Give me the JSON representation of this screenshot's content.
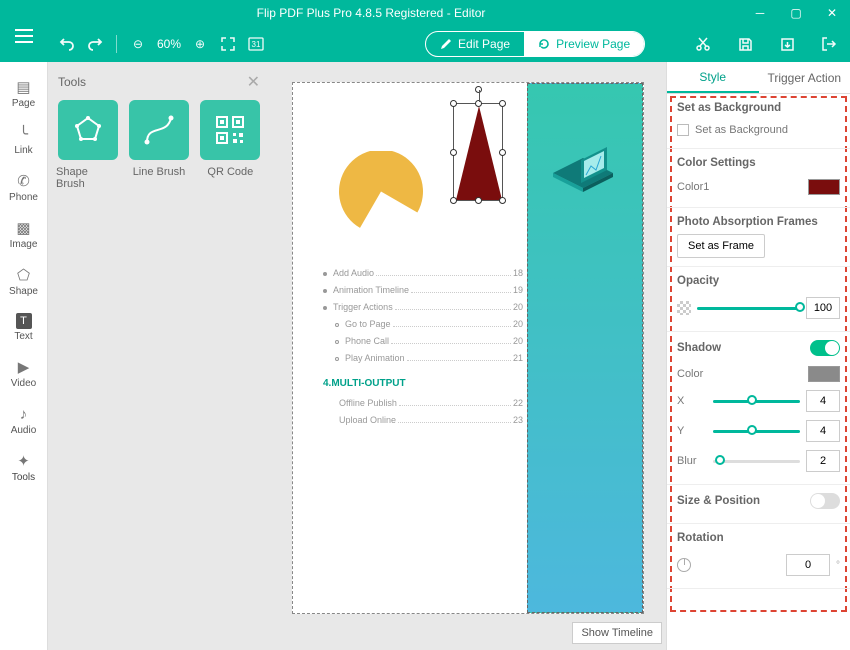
{
  "window": {
    "title": "Flip PDF Plus Pro 4.8.5 Registered - Editor"
  },
  "toolbar": {
    "zoom": "60%"
  },
  "mode": {
    "edit": "Edit Page",
    "preview": "Preview Page"
  },
  "nav": {
    "page": "Page",
    "link": "Link",
    "phone": "Phone",
    "image": "Image",
    "shape": "Shape",
    "text": "Text",
    "video": "Video",
    "audio": "Audio",
    "tools": "Tools"
  },
  "toolsPanel": {
    "title": "Tools",
    "shapeBrush": "Shape Brush",
    "lineBrush": "Line Brush",
    "qr": "QR Code"
  },
  "toc": {
    "items": [
      {
        "t": "bul",
        "label": "Add Audio",
        "pg": "18"
      },
      {
        "t": "bul",
        "label": "Animation Timeline",
        "pg": "19"
      },
      {
        "t": "bul",
        "label": "Trigger Actions",
        "pg": "20"
      },
      {
        "t": "cir",
        "label": "Go to Page",
        "pg": "20"
      },
      {
        "t": "cir",
        "label": "Phone Call",
        "pg": "20"
      },
      {
        "t": "cir",
        "label": "Play Animation",
        "pg": "21"
      }
    ],
    "section": "4.MULTI-OUTPUT",
    "after": [
      {
        "label": "Offline Publish",
        "pg": "22"
      },
      {
        "label": "Upload Online",
        "pg": "23"
      }
    ]
  },
  "showTimeline": "Show Timeline",
  "props": {
    "tabs": {
      "style": "Style",
      "trigger": "Trigger Action"
    },
    "setBg": {
      "title": "Set as Background",
      "label": "Set as Background"
    },
    "colorSettings": {
      "title": "Color Settings",
      "color1": "Color1",
      "color1_hex": "#7a0d0d"
    },
    "frames": {
      "title": "Photo Absorption Frames",
      "btn": "Set as Frame"
    },
    "opacity": {
      "title": "Opacity",
      "value": "100"
    },
    "shadow": {
      "title": "Shadow",
      "color": "Color",
      "x": "X",
      "xv": "4",
      "y": "Y",
      "yv": "4",
      "blur": "Blur",
      "bv": "2",
      "color_hex": "#8a8a8a"
    },
    "sizePos": {
      "title": "Size & Position"
    },
    "rotation": {
      "title": "Rotation",
      "value": "0"
    }
  }
}
